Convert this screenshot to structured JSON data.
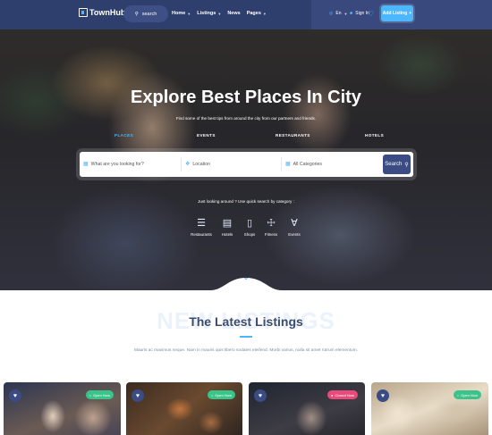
{
  "header": {
    "logo_text": "TownHub.",
    "search_label": "search",
    "nav": [
      {
        "label": "Home",
        "has_dropdown": true
      },
      {
        "label": "Listings",
        "has_dropdown": true
      },
      {
        "label": "News",
        "has_dropdown": false
      },
      {
        "label": "Pages",
        "has_dropdown": true
      }
    ],
    "language": "En",
    "sign_in": "Sign In",
    "add_listing": "Add Listing"
  },
  "hero": {
    "title": "Explore Best Places In City",
    "subtitle": "Find some of the best tips from around the city from our partners and friends.",
    "tabs": [
      {
        "label": "PLACES",
        "active": true
      },
      {
        "label": "EVENTS",
        "active": false
      },
      {
        "label": "RESTAURANTS",
        "active": false
      },
      {
        "label": "HOTELS",
        "active": false
      }
    ],
    "search": {
      "keyword_placeholder": "What are you looking for?",
      "location_placeholder": "Location",
      "category_value": "All Categories",
      "button_label": "Search"
    },
    "quick_text": "Just looking around ? Use quick search by category :",
    "categories": [
      {
        "label": "Restaurants",
        "icon": "burger-icon"
      },
      {
        "label": "Hotels",
        "icon": "bed-icon"
      },
      {
        "label": "Shops",
        "icon": "shopping-bag-icon"
      },
      {
        "label": "Fitness",
        "icon": "dumbbell-icon"
      },
      {
        "label": "Events",
        "icon": "cocktail-icon"
      }
    ]
  },
  "latest": {
    "background_word": "NEW LISTINGS",
    "title": "The Latest Listings",
    "description": "Mauris ac maximus neque. Nam in mauris quis libero sodales eleifend. Morbi varius, nulla sit amet rutrum elementum."
  },
  "cards": [
    {
      "status": "Open Now",
      "state": "open"
    },
    {
      "status": "Open Now",
      "state": "open"
    },
    {
      "status": "Closed Now",
      "state": "closed"
    },
    {
      "status": "Open Now",
      "state": "open"
    }
  ],
  "colors": {
    "header": "#2e3f6e",
    "accent": "#4db7fe",
    "open": "#3ac48a",
    "closed": "#e84a7c"
  }
}
